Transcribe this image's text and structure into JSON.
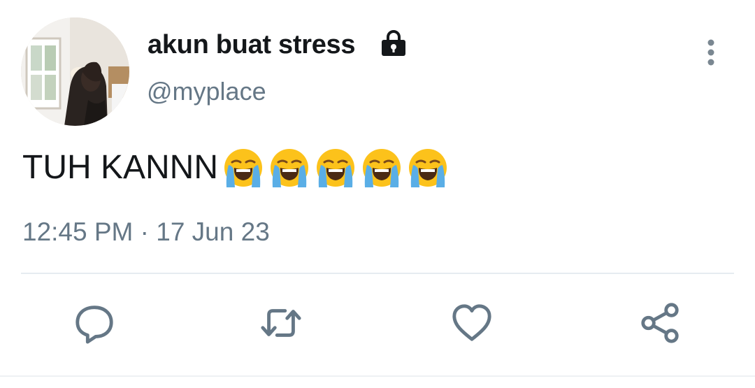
{
  "tweet": {
    "display_name": "akun buat stress",
    "handle": "@myplace",
    "text": "TUH KANNN",
    "emojis": [
      "crying-face",
      "crying-face",
      "crying-face",
      "crying-face",
      "crying-face"
    ],
    "timestamp": "12:45 PM · 17 Jun 23",
    "account_locked": true
  },
  "icons": {
    "lock": "lock-icon",
    "more": "more-vertical-icon",
    "reply": "reply-icon",
    "retweet": "retweet-icon",
    "like": "heart-icon",
    "share": "share-icon"
  },
  "colors": {
    "text": "#14171a",
    "secondary": "#657786",
    "divider": "#e6ecf0",
    "emoji_yellow": "#fcc21b",
    "emoji_tears": "#5aaee6"
  }
}
